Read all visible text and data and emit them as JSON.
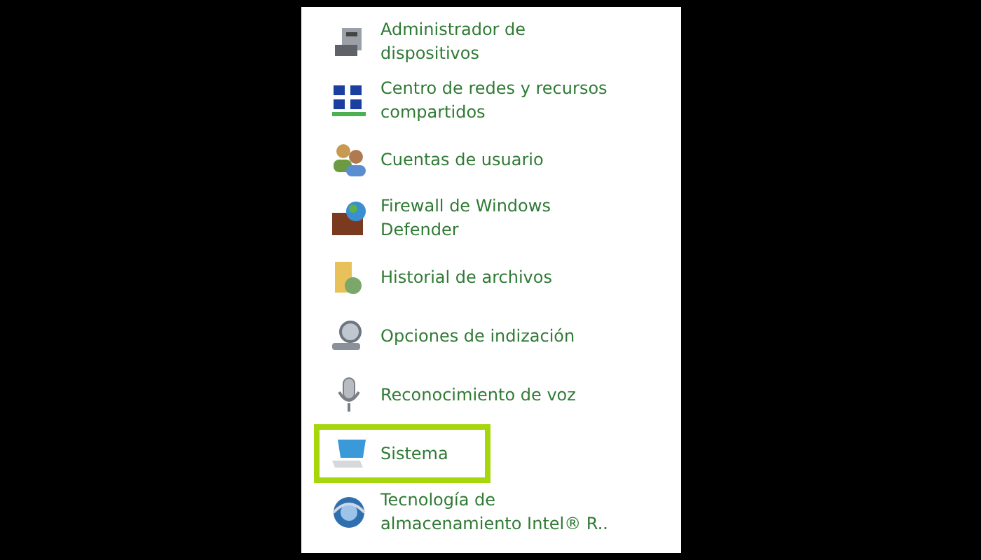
{
  "items": [
    {
      "label": "Administrador de\ndispositivos",
      "highlighted": false
    },
    {
      "label": "Centro de redes y recursos\ncompartidos",
      "highlighted": false
    },
    {
      "label": "Cuentas de usuario",
      "highlighted": false
    },
    {
      "label": "Firewall de Windows\nDefender",
      "highlighted": false
    },
    {
      "label": "Historial de archivos",
      "highlighted": false
    },
    {
      "label": "Opciones de indización",
      "highlighted": false
    },
    {
      "label": "Reconocimiento de voz",
      "highlighted": false
    },
    {
      "label": "Sistema",
      "highlighted": true
    },
    {
      "label": "Tecnología de\nalmacenamiento Intel® R..",
      "highlighted": false
    }
  ]
}
